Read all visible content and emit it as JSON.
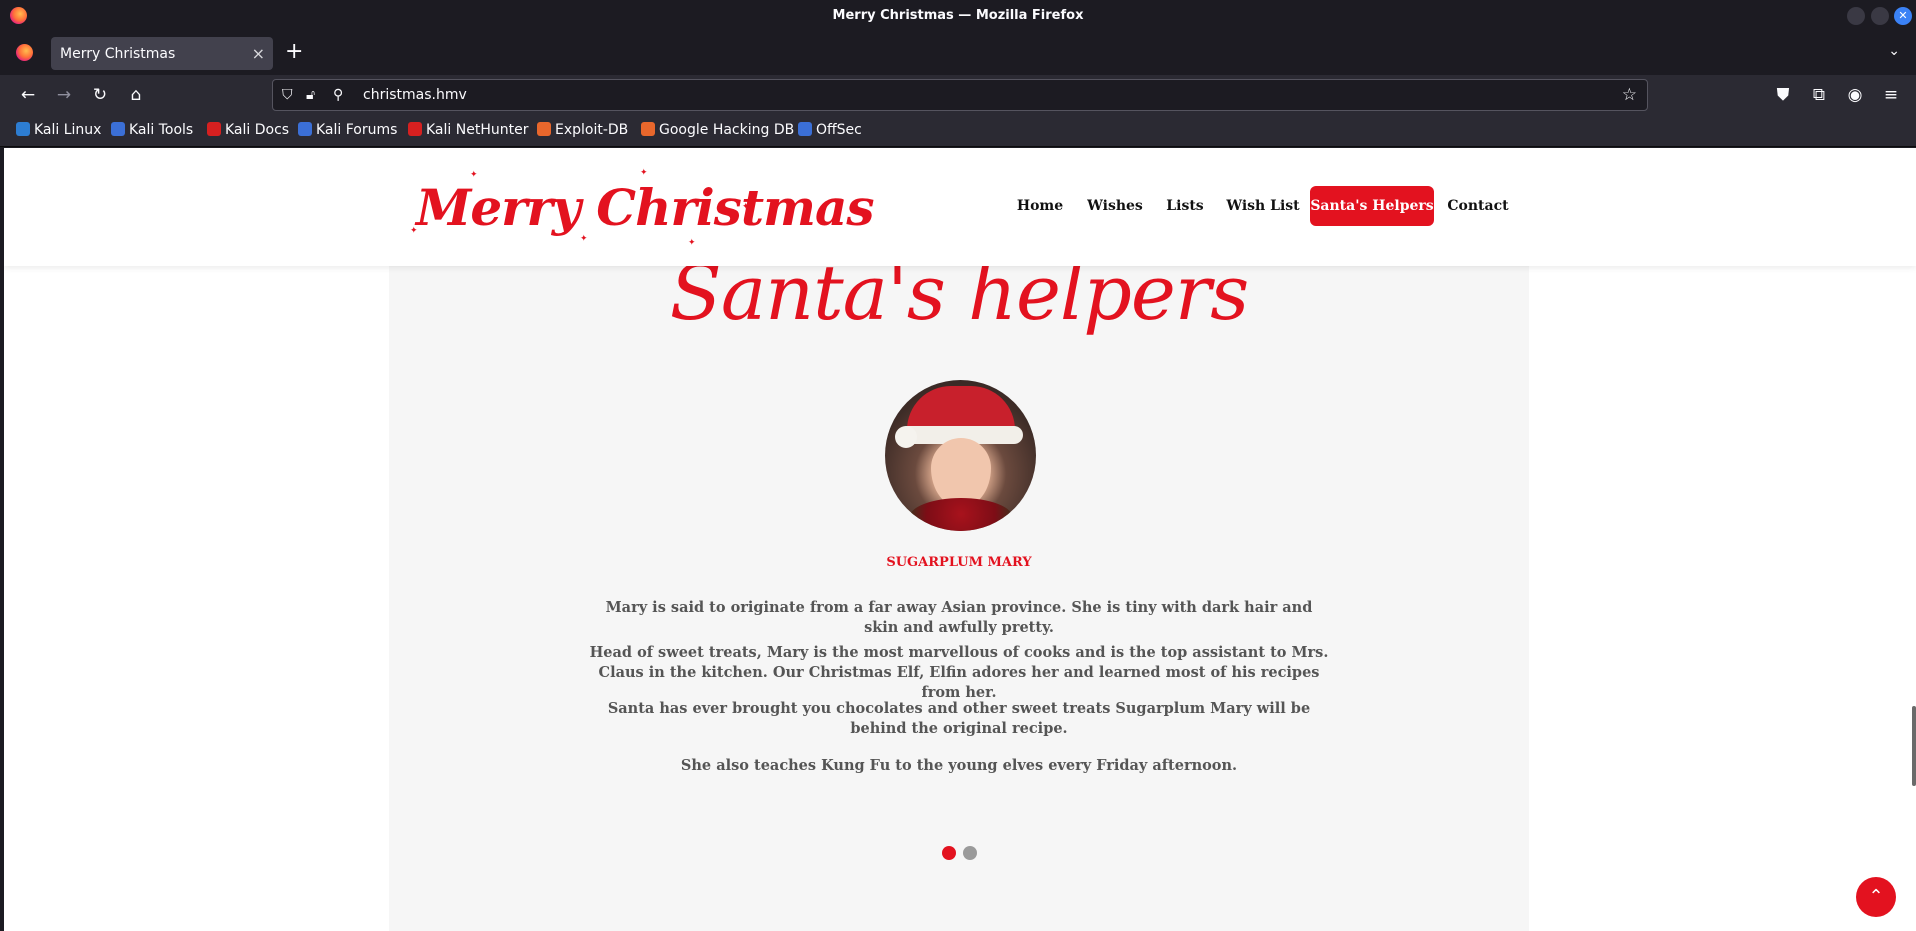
{
  "window": {
    "title": "Merry Christmas — Mozilla Firefox"
  },
  "tab": {
    "label": "Merry Christmas",
    "close": "×"
  },
  "toolbar": {
    "new_tab": "+",
    "list_all_tabs": "⌄"
  },
  "url": {
    "value": "christmas.hmv"
  },
  "bookmarks": [
    {
      "label": "Kali Linux",
      "color": "#2d7dd2"
    },
    {
      "label": "Kali Tools",
      "color": "#3b6fd6"
    },
    {
      "label": "Kali Docs",
      "color": "#d62020"
    },
    {
      "label": "Kali Forums",
      "color": "#3b6fd6"
    },
    {
      "label": "Kali NetHunter",
      "color": "#d62020"
    },
    {
      "label": "Exploit-DB",
      "color": "#e8672c"
    },
    {
      "label": "Google Hacking DB",
      "color": "#e8672c"
    },
    {
      "label": "OffSec",
      "color": "#3b6fd6"
    }
  ],
  "site": {
    "logo_text": "Merry Christmas",
    "menu": [
      {
        "label": "Home"
      },
      {
        "label": "Wishes"
      },
      {
        "label": "Lists"
      },
      {
        "label": "Wish List"
      },
      {
        "label": "Santa's Helpers",
        "active": true
      },
      {
        "label": "Contact"
      }
    ]
  },
  "section": {
    "title": "Santa's helpers",
    "helper": {
      "name": "SUGARPLUM MARY",
      "paragraphs": [
        "Mary is said to originate from a far away Asian province. She is tiny with dark hair and skin and awfully pretty.",
        "Head of sweet treats, Mary is the most marvellous of cooks and is the top assistant to Mrs. Claus in the kitchen. Our Christmas Elf, Elfin adores her and learned most of his recipes from her.",
        "Santa has ever brought you chocolates and other sweet treats Sugarplum Mary will be behind the original recipe.",
        "She also teaches Kung Fu to the young elves every Friday afternoon."
      ]
    },
    "carousel": {
      "slides": 2,
      "active_index": 0
    }
  },
  "colors": {
    "brand_red": "#e3121f",
    "text_gray": "#555555"
  },
  "icons": {
    "back": "back-arrow-icon",
    "forward": "forward-arrow-icon",
    "reload": "reload-icon",
    "home": "home-icon",
    "shield": "shield-icon",
    "lock": "lock-icon",
    "permissions": "permissions-icon",
    "bookmark_star": "star-icon",
    "pocket": "pocket-icon",
    "extensions": "extensions-icon",
    "account": "account-icon",
    "menu": "hamburger-menu-icon",
    "back_to_top": "chevron-up-icon"
  }
}
